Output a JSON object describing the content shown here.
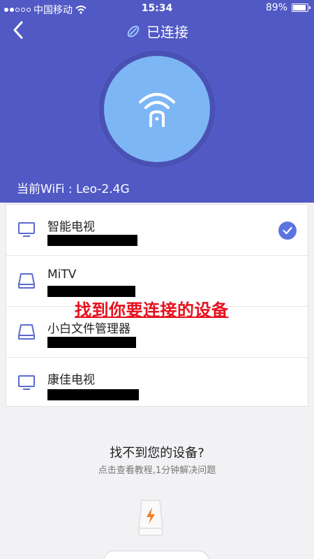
{
  "status_bar": {
    "carrier": "中国移动",
    "time": "15:34",
    "battery": "89%",
    "battery_level": 0.89
  },
  "nav": {
    "title": "已连接"
  },
  "header": {
    "current_wifi": "当前WiFi : Leo-2.4G"
  },
  "devices": [
    {
      "name": "智能电视",
      "icon": "tv-icon",
      "selected": true
    },
    {
      "name": "MiTV",
      "icon": "drive-icon",
      "selected": false
    },
    {
      "name": "小白文件管理器",
      "icon": "drive-icon",
      "selected": false
    },
    {
      "name": "康佳电视",
      "icon": "tv-icon",
      "selected": false
    }
  ],
  "overlay": {
    "text": "找到你要连接的设备"
  },
  "help": {
    "title": "找不到您的设备?",
    "subtitle": "点击查看教程,1分钟解决问题"
  },
  "colors": {
    "header_bg": "#5159c4",
    "circle": "#7cb6f4",
    "check": "#5b74e0",
    "overlay_red": "#e8101d"
  }
}
